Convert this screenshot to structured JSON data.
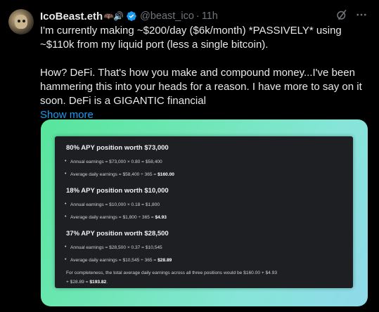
{
  "tweet": {
    "display_name": "IcoBeast.eth",
    "name_emojis": "🦇🔊",
    "handle": "@beast_ico",
    "separator": "·",
    "time": "11h",
    "text_line1": "I'm currently making ~$200/day ($6k/month) *PASSIVELY* using ~$110k from my liquid port (less a single bitcoin).",
    "text_line2": "How? DeFi. That's how you make and compound money...I've been hammering this into your heads for a reason. I have more to say on it soon. DeFi is a GIGANTIC financial",
    "show_more": "Show more",
    "verified_color": "#1d9bf0",
    "link_color": "#1d9bf0"
  },
  "card": {
    "sections": [
      {
        "title": "80% APY position worth $73,000",
        "annual": "Annual earnings = $73,000 × 0.80 = $58,400",
        "daily_prefix": "Average daily earnings = $58,400 ÷ 365 = ",
        "daily_result": "$160.00"
      },
      {
        "title": "18% APY position worth $10,000",
        "annual": "Annual earnings = $10,000 × 0.18 = $1,800",
        "daily_prefix": "Average daily earnings = $1,800 ÷ 365 = ",
        "daily_result": "$4.93"
      },
      {
        "title": "37% APY position worth $28,500",
        "annual": "Annual earnings = $28,500 × 0.37 = $10,545",
        "daily_prefix": "Average daily earnings = $10,545 ÷ 365 = ",
        "daily_result": "$28.89"
      }
    ],
    "summary_line1": "For completeness, the total average daily earnings across all three positions would be $160.00 + $4.93",
    "summary_line2_prefix": "+ $28.89 = ",
    "summary_total": "$193.82",
    "summary_line2_suffix": "."
  }
}
